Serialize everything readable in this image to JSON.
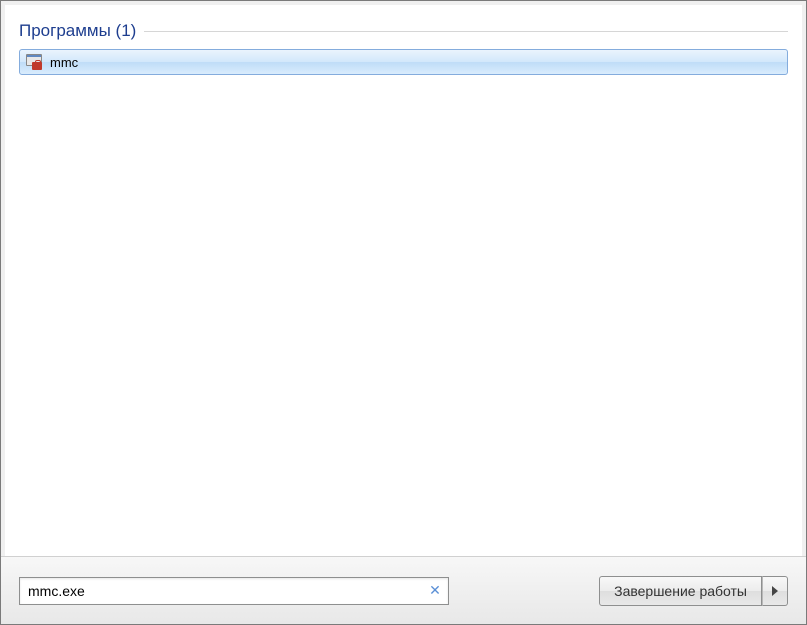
{
  "search": {
    "category_label": "Программы (1)",
    "results": [
      {
        "name": "mmc",
        "icon": "mmc-icon"
      }
    ],
    "input_value": "mmc.exe"
  },
  "shutdown": {
    "label": "Завершение работы"
  }
}
